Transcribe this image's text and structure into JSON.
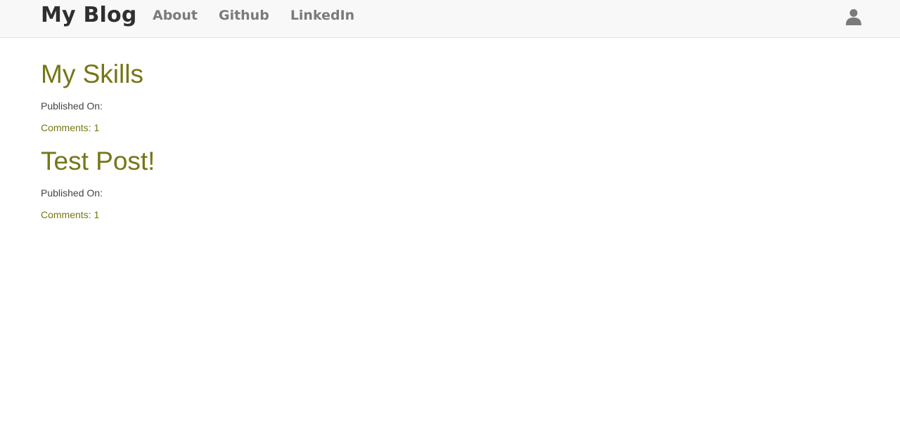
{
  "navbar": {
    "brand": "My Blog",
    "links": [
      {
        "label": "About"
      },
      {
        "label": "Github"
      },
      {
        "label": "LinkedIn"
      }
    ],
    "user_icon": "user-icon"
  },
  "posts": [
    {
      "title": "My Skills",
      "published_label": "Published On:",
      "comments_label": "Comments: 1"
    },
    {
      "title": "Test Post!",
      "published_label": "Published On:",
      "comments_label": "Comments: 1"
    }
  ],
  "colors": {
    "accent": "#767617",
    "navbar_bg": "#f8f8f8",
    "brand": "#2f2f2f",
    "nav_link": "#7a7a7a"
  }
}
